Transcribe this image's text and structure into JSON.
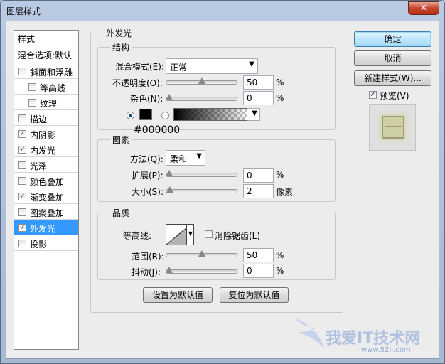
{
  "window": {
    "title": "图层样式",
    "close_glyph": "✕"
  },
  "styles_list": {
    "header": "样式",
    "blend_options": "混合选项:默认",
    "items": [
      {
        "label": "斜面和浮雕",
        "checked": false
      },
      {
        "label": "等高线",
        "checked": false
      },
      {
        "label": "纹理",
        "checked": false
      },
      {
        "label": "描边",
        "checked": false
      },
      {
        "label": "内阴影",
        "checked": true
      },
      {
        "label": "内发光",
        "checked": true
      },
      {
        "label": "光泽",
        "checked": false
      },
      {
        "label": "颜色叠加",
        "checked": false
      },
      {
        "label": "渐变叠加",
        "checked": true
      },
      {
        "label": "图案叠加",
        "checked": false
      },
      {
        "label": "外发光",
        "checked": true,
        "selected": true
      },
      {
        "label": "投影",
        "checked": false
      }
    ]
  },
  "panel": {
    "title": "外发光",
    "structure": {
      "title": "结构",
      "blend_mode_label": "混合模式(E):",
      "blend_mode_value": "正常",
      "opacity_label": "不透明度(O):",
      "opacity_value": "50",
      "opacity_level": 0.5,
      "noise_label": "杂色(N):",
      "noise_value": "0",
      "noise_level": 0,
      "percent": "%",
      "color_hex": "#000000",
      "color_mode": "solid"
    },
    "elements": {
      "title": "图素",
      "method_label": "方法(Q):",
      "method_value": "柔和",
      "spread_label": "扩展(P):",
      "spread_value": "0",
      "spread_level": 0,
      "size_label": "大小(S):",
      "size_value": "2",
      "size_unit": "像素",
      "size_level": 0.01
    },
    "quality": {
      "title": "品质",
      "contour_label": "等高线:",
      "antialias_label": "消除锯齿(L)",
      "antialias_checked": false,
      "range_label": "范围(R):",
      "range_value": "50",
      "range_level": 0.5,
      "jitter_label": "抖动(J):",
      "jitter_value": "0",
      "jitter_level": 0
    },
    "make_default": "设置为默认值",
    "reset_default": "复位为默认值"
  },
  "buttons": {
    "ok": "确定",
    "cancel": "取消",
    "new_style": "新建样式(W)...",
    "preview_label": "预览(V)",
    "preview_checked": true
  },
  "watermark": {
    "text": "我爱IT技术网",
    "url": "www.52ij.com"
  },
  "colors": {
    "selection": "#3399ff",
    "glow_color": "#000000"
  }
}
